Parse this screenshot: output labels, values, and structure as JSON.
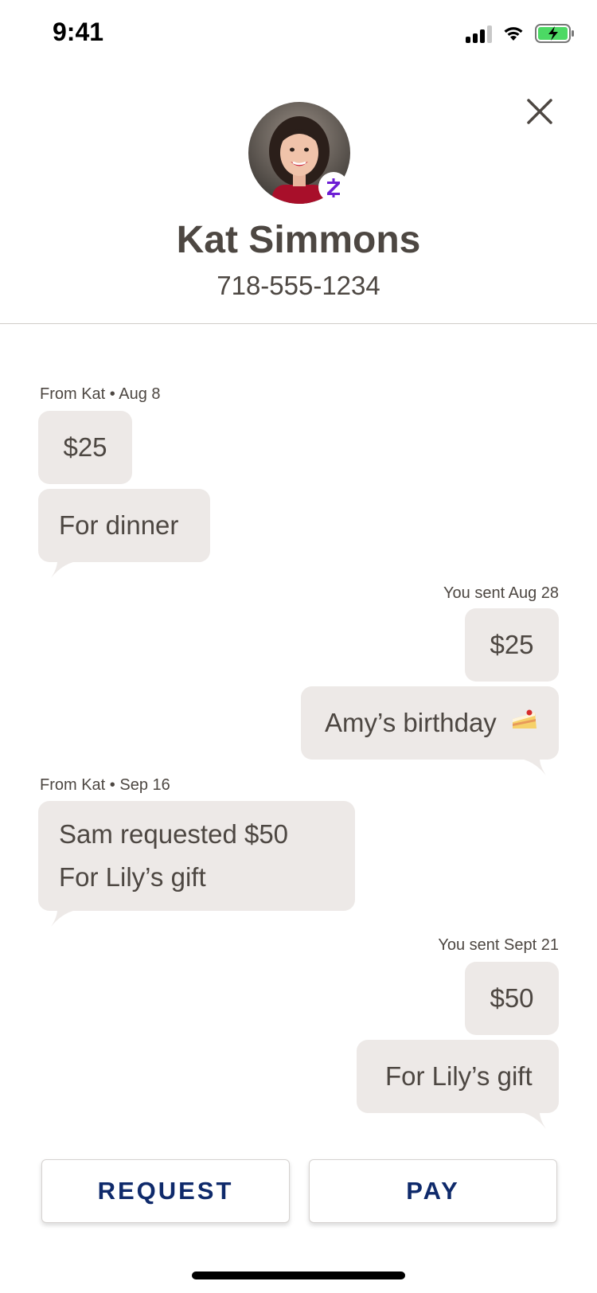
{
  "status_bar": {
    "time": "9:41"
  },
  "contact": {
    "name": "Kat Simmons",
    "phone": "718-555-1234",
    "badge_glyph": "Z"
  },
  "messages": [
    {
      "meta": "From Kat • Aug 8",
      "amount": "$25",
      "note": "For dinner",
      "direction": "received"
    },
    {
      "meta": "You sent Aug 28",
      "amount": "$25",
      "note": "Amy’s birthday",
      "note_icon": "cake-icon",
      "direction": "sent"
    },
    {
      "meta": "From Kat • Sep 16",
      "request_line": "Sam requested $50",
      "note": "For Lily’s gift",
      "direction": "received"
    },
    {
      "meta": "You sent Sept 21",
      "amount": "$50",
      "note": "For Lily’s gift",
      "direction": "sent"
    }
  ],
  "actions": {
    "request_label": "REQUEST",
    "pay_label": "PAY"
  },
  "colors": {
    "bubble": "#ede9e7",
    "text": "#4d4742",
    "button_text": "#0f2a6b",
    "brand_purple": "#6d1ed4"
  }
}
